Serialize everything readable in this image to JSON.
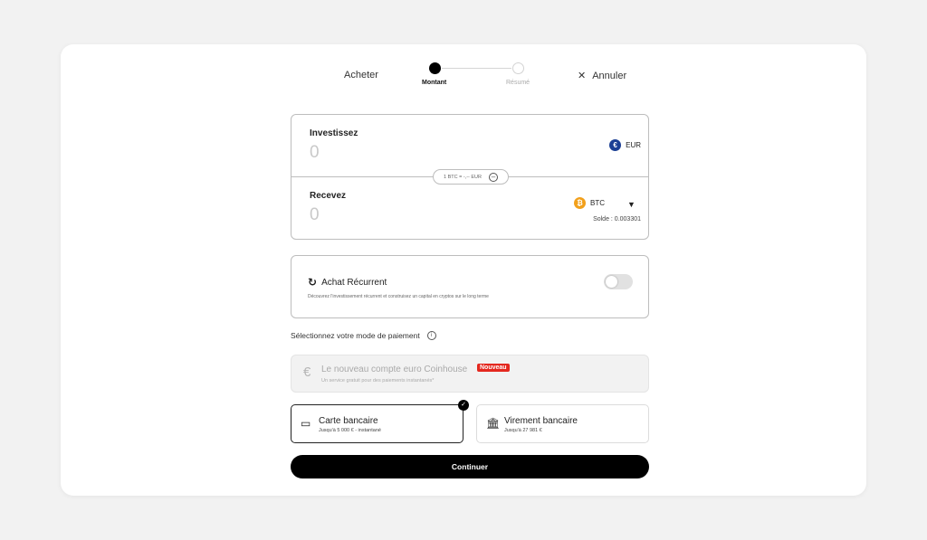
{
  "header": {
    "title": "Acheter",
    "steps": [
      {
        "label": "Montant",
        "active": true
      },
      {
        "label": "Résumé",
        "active": false
      }
    ],
    "cancel_label": "Annuler",
    "cancel_icon": "close-icon"
  },
  "invest": {
    "label": "Investissez",
    "value": "0",
    "currency": "EUR",
    "currency_icon": "euro-coin-icon"
  },
  "rate": {
    "text": "1 BTC = -,-- EUR",
    "icon": "swap-icon"
  },
  "receive": {
    "label": "Recevez",
    "value": "0",
    "currency": "BTC",
    "currency_icon": "bitcoin-coin-icon",
    "balance": "Solde : 0.003301"
  },
  "recurrent": {
    "title": "Achat Récurrent",
    "description": "Découvrez l'investissement récurrent et construisez un capital en cryptos sur le long terme",
    "enabled": false
  },
  "payment": {
    "label": "Sélectionnez votre mode de paiement",
    "coinhouse": {
      "title": "Le nouveau compte euro Coinhouse",
      "badge": "Nouveau",
      "subtitle": "Un service gratuit pour des paiements instantanés*"
    },
    "options": [
      {
        "title": "Carte bancaire",
        "subtitle": "Jusqu'à 5 000 € - instantané",
        "selected": true
      },
      {
        "title": "Virement bancaire",
        "subtitle": "Jusqu'à 27 981 €",
        "selected": false
      }
    ]
  },
  "continue_label": "Continuer",
  "colors": {
    "primary": "#000000",
    "eur_coin": "#1b3f94",
    "btc_coin": "#f2a01b",
    "badge": "#e4281f"
  }
}
